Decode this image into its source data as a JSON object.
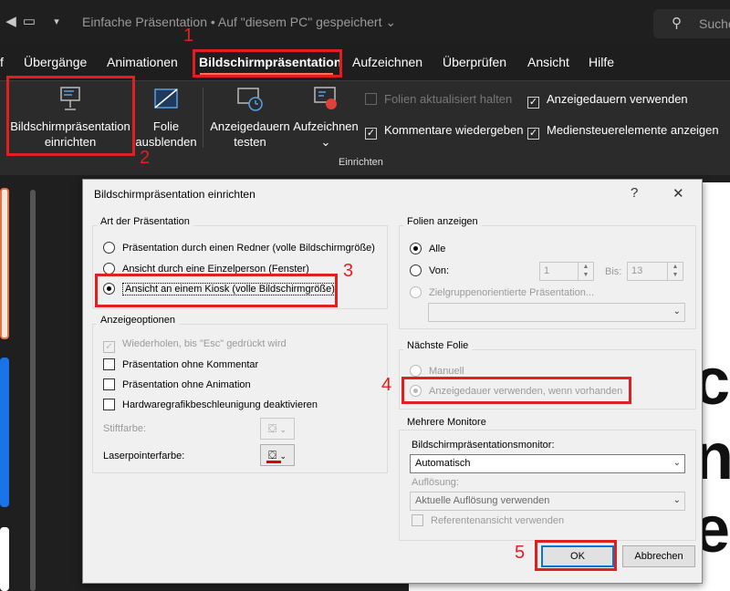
{
  "titlebar": {
    "doc_title": "Einfache Präsentation • Auf \"diesem PC\" gespeichert ⌄",
    "search_text": "Suche"
  },
  "tabs": [
    "f",
    "Übergänge",
    "Animationen",
    "Bildschirmpräsentation",
    "Aufzeichnen",
    "Überprüfen",
    "Ansicht",
    "Hilfe"
  ],
  "ribbon": {
    "setup_line1": "Bildschirmpräsentation",
    "setup_line2": "einrichten",
    "hide_line1": "Folie",
    "hide_line2": "ausblenden",
    "rehearse_line1": "Anzeigedauern",
    "rehearse_line2": "testen",
    "record_label": "Aufzeichnen",
    "record_caret": "⌄",
    "chk_update": "Folien aktualisiert halten",
    "chk_narrations": "Kommentare wiedergeben",
    "chk_timings": "Anzeigedauern verwenden",
    "chk_media": "Mediensteuerelemente anzeigen",
    "group_label": "Einrichten"
  },
  "steps": {
    "s1": "1",
    "s2": "2",
    "s3": "3",
    "s4": "4",
    "s5": "5"
  },
  "slide_text": {
    "l1": "c",
    "l2": "n",
    "l3": "e"
  },
  "dialog": {
    "title": "Bildschirmpräsentation einrichten",
    "help": "?",
    "close": "✕",
    "type_group": "Art der Präsentation",
    "type_presenter": "Präsentation durch einen Redner (volle Bildschirmgröße)",
    "type_individual": "Ansicht durch eine Einzelperson (Fenster)",
    "type_kiosk": "Ansicht an einem Kiosk (volle Bildschirmgröße)",
    "options_group": "Anzeigeoptionen",
    "opt_loop": "Wiederholen, bis \"Esc\" gedrückt wird",
    "opt_no_narration": "Präsentation ohne Kommentar",
    "opt_no_animation": "Präsentation ohne Animation",
    "opt_no_hwaccel": "Hardwaregrafikbeschleunigung deaktivieren",
    "pen_color": "Stiftfarbe:",
    "laser_color": "Laserpointerfarbe:",
    "slides_group": "Folien anzeigen",
    "slides_all": "Alle",
    "slides_from": "Von:",
    "slides_from_value": "1",
    "slides_to": "Bis:",
    "slides_to_value": "13",
    "slides_custom": "Zielgruppenorientierte Präsentation...",
    "advance_group": "Nächste Folie",
    "advance_manual": "Manuell",
    "advance_timings": "Anzeigedauer verwenden, wenn vorhanden",
    "monitors_group": "Mehrere Monitore",
    "monitor_label": "Bildschirmpräsentationsmonitor:",
    "monitor_value": "Automatisch",
    "resolution_label": "Auflösung:",
    "resolution_value": "Aktuelle Auflösung verwenden",
    "presenter_view": "Referentenansicht verwenden",
    "ok": "OK",
    "cancel": "Abbrechen"
  },
  "colors": {
    "accent": "#ff6f5e",
    "annotation": "#e02020",
    "laser": "#e00000"
  }
}
